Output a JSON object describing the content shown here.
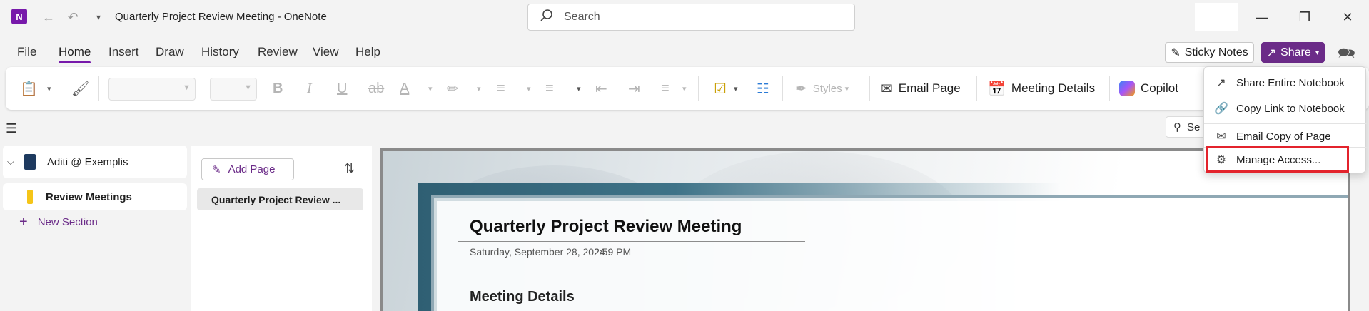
{
  "window": {
    "title": "Quarterly Project Review Meeting  -  OneNote",
    "search_placeholder": "Search"
  },
  "menu_tabs": [
    "File",
    "Home",
    "Insert",
    "Draw",
    "History",
    "Review",
    "View",
    "Help"
  ],
  "active_tab": "Home",
  "header_buttons": {
    "sticky_notes": "Sticky Notes",
    "share": "Share"
  },
  "ribbon": {
    "styles_label": "Styles",
    "email_page": "Email Page",
    "meeting_details": "Meeting Details",
    "copilot": "Copilot"
  },
  "share_menu": {
    "items": [
      {
        "label": "Share Entire Notebook",
        "icon": "share-notebook-icon"
      },
      {
        "label": "Copy Link to Notebook",
        "icon": "link-icon"
      },
      {
        "label": "Email Copy of Page",
        "icon": "envelope-icon"
      },
      {
        "label": "Manage Access...",
        "icon": "gear-icon"
      }
    ],
    "highlighted": "Manage Access..."
  },
  "notebook": {
    "name": "Aditi @ Exemplis",
    "section": "Review Meetings",
    "new_section": "New Section"
  },
  "pages": {
    "add_page": "Add Page",
    "items": [
      "Quarterly Project Review ..."
    ]
  },
  "search_small": "Se",
  "note": {
    "title": "Quarterly Project Review Meeting",
    "date": "Saturday, September 28, 2024",
    "time": "2:59 PM",
    "heading": "Meeting Details"
  },
  "colors": {
    "accent": "#7719aa",
    "share_button": "#6b2b88",
    "highlight_box": "#e3232c",
    "section_tab": "#f5c518"
  }
}
